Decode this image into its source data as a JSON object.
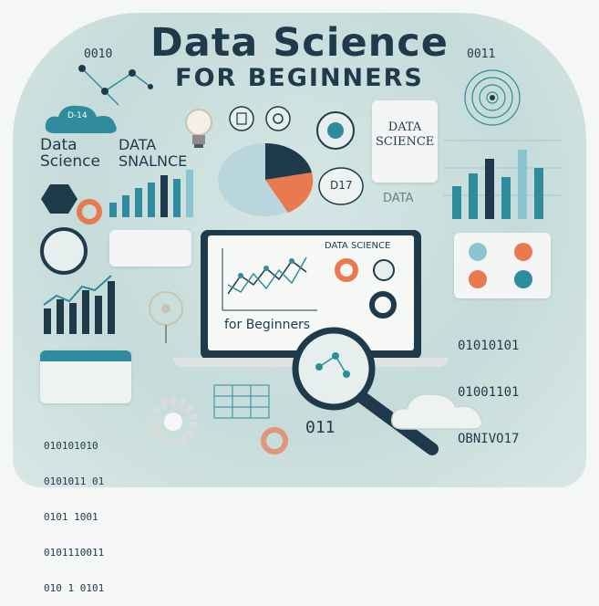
{
  "header": {
    "title": "Data Science",
    "subtitle": "FOR BEGINNERS"
  },
  "labels": {
    "binary_tl": "0010",
    "binary_tr": "0011",
    "cloud_text": "D-14",
    "data_science_left": "Data\nScience",
    "data_analysis_left": "DATA\nSNALNCE",
    "pie_bubble": "D17",
    "clipboard_title": "DATA\nSCIENCE",
    "data_small": "DATA",
    "laptop_title": "DATA SCIENCE",
    "laptop_subtitle": "for Beginners",
    "binary_center": "011"
  },
  "binary_block_right": [
    "01010101",
    "01001101",
    "OBNIVO17"
  ],
  "binary_block_left": [
    "010101010",
    "0101011 01",
    "0101 1001",
    "0101110011",
    "010 1 0101"
  ],
  "icons": [
    "network-graph-icon",
    "cloud-icon",
    "lightbulb-icon",
    "database-icon",
    "pie-chart-icon",
    "bar-chart-icon",
    "clipboard-icon",
    "laptop-icon",
    "magnifying-glass-icon",
    "gear-icon",
    "calendar-icon",
    "radial-chart-icon",
    "fan-icon"
  ],
  "colors": {
    "navy": "#1f3a4a",
    "teal": "#2e8c9c",
    "orange": "#e9794f",
    "light_teal": "#8cc4cf"
  }
}
